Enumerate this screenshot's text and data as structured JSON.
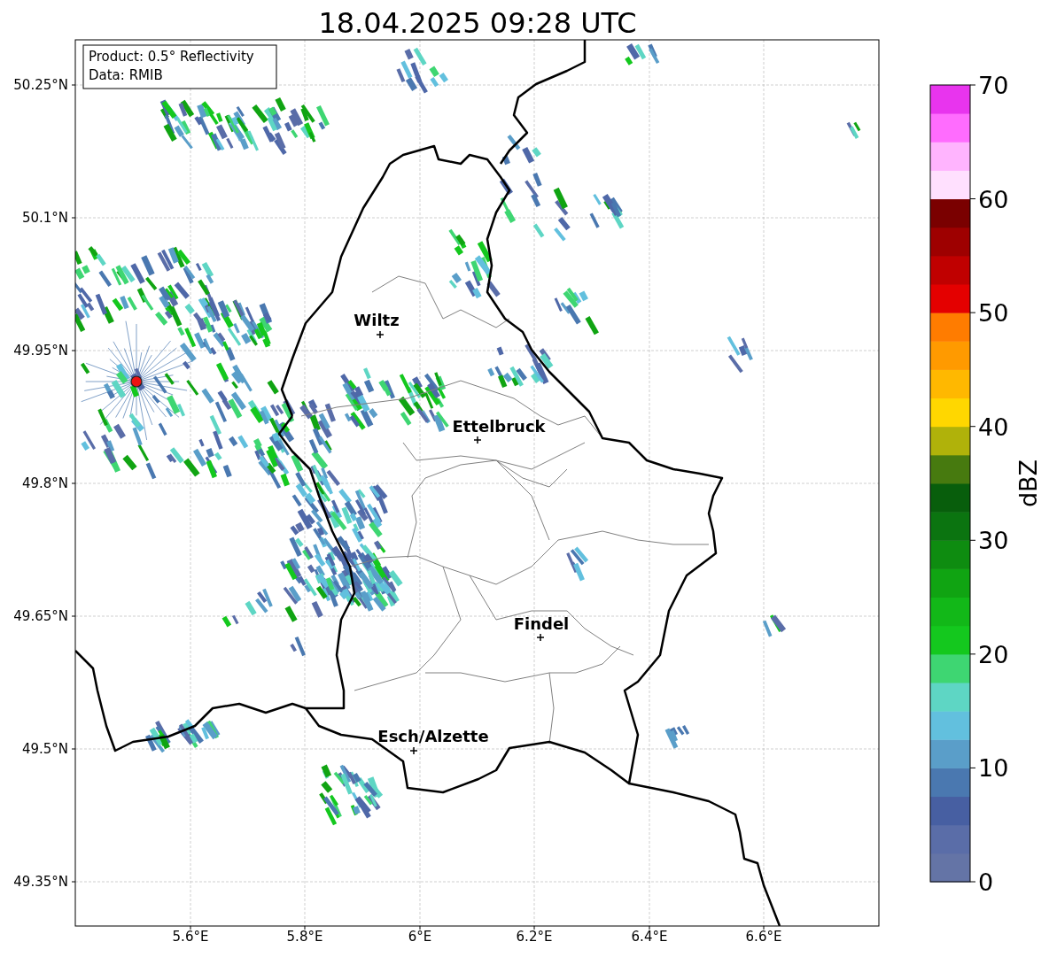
{
  "title": "18.04.2025 09:28 UTC",
  "legend": {
    "lines": [
      "Product: 0.5° Reflectivity",
      "Data: RMIB"
    ]
  },
  "map": {
    "x_ticks": [
      "5.6°E",
      "5.8°E",
      "6°E",
      "6.2°E",
      "6.4°E",
      "6.6°E"
    ],
    "y_ticks": [
      "50.25°N",
      "50.1°N",
      "49.95°N",
      "49.8°N",
      "49.65°N",
      "49.5°N",
      "49.35°N"
    ],
    "cities": [
      {
        "label": "Wiltz"
      },
      {
        "label": "Ettelbruck"
      },
      {
        "label": "Findel"
      },
      {
        "label": "Esch/Alzette"
      }
    ]
  },
  "colorbar": {
    "label": "dBZ",
    "ticks": [
      "70",
      "60",
      "50",
      "40",
      "30",
      "20",
      "10",
      "0"
    ]
  }
}
